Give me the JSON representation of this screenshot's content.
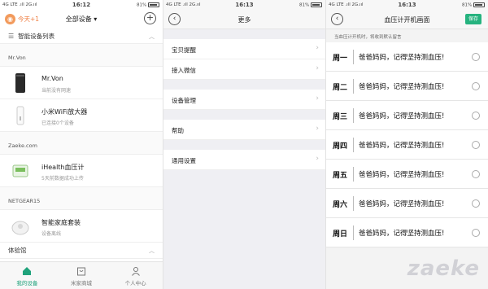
{
  "screens": [
    {
      "status": {
        "carrier": "4G LTE .ıll 2G.ııl",
        "time": "16:12",
        "battery": "81%"
      },
      "header": {
        "today_label": "今天+1",
        "dropdown_label": "全部设备 ▾",
        "add_label": "+"
      },
      "list_title": "智能设备列表",
      "groups": [
        {
          "label": "Mr.Von",
          "devices": [
            {
              "name": "Mr.Von",
              "status": "当前没有网速"
            },
            {
              "name": "小米WiFi放大器",
              "status": "已连接0个设备"
            }
          ]
        },
        {
          "label": "Zaeke.com",
          "devices": [
            {
              "name": "iHealth血压计",
              "status": "5天前数据成功上传"
            }
          ]
        },
        {
          "label": "NETGEAR15",
          "devices": [
            {
              "name": "智能家庭套装",
              "status": "设备离线"
            }
          ]
        },
        {
          "label": "体验馆",
          "devices": []
        }
      ],
      "tabs": [
        {
          "label": "我的设备"
        },
        {
          "label": "米家商城"
        },
        {
          "label": "个人中心"
        }
      ]
    },
    {
      "status": {
        "carrier": "4G LTE .ıll 2G.ııl",
        "time": "16:13",
        "battery": "81%"
      },
      "title": "更多",
      "menu": [
        {
          "label": "宝贝提醒"
        },
        {
          "label": "接入微信"
        },
        {
          "label": "设备管理"
        },
        {
          "label": "帮助"
        },
        {
          "label": "通用设置"
        }
      ]
    },
    {
      "status": {
        "carrier": "4G LTE .ıll 2G.ııl",
        "time": "16:13",
        "battery": "81%"
      },
      "title": "血压计开机画面",
      "save_label": "保存",
      "hint": "当血压计开机时，将收到默认留言",
      "days": [
        {
          "day": "周一",
          "message": "爸爸妈妈，记得坚持测血压!"
        },
        {
          "day": "周二",
          "message": "爸爸妈妈，记得坚持测血压!"
        },
        {
          "day": "周三",
          "message": "爸爸妈妈，记得坚持测血压!"
        },
        {
          "day": "周四",
          "message": "爸爸妈妈，记得坚持测血压!"
        },
        {
          "day": "周五",
          "message": "爸爸妈妈，记得坚持测血压!"
        },
        {
          "day": "周六",
          "message": "爸爸妈妈，记得坚持测血压!"
        },
        {
          "day": "周日",
          "message": "爸爸妈妈，记得坚持测血压!"
        }
      ]
    }
  ],
  "watermark": "zaeke",
  "colors": {
    "accent_green": "#26b37f",
    "today_orange": "#ef7b3e"
  },
  "icons": {
    "tab_icons": [
      "home-icon",
      "shop-icon",
      "person-icon"
    ],
    "chevron": "chevron-right-icon",
    "back": "back-arrow-icon"
  }
}
